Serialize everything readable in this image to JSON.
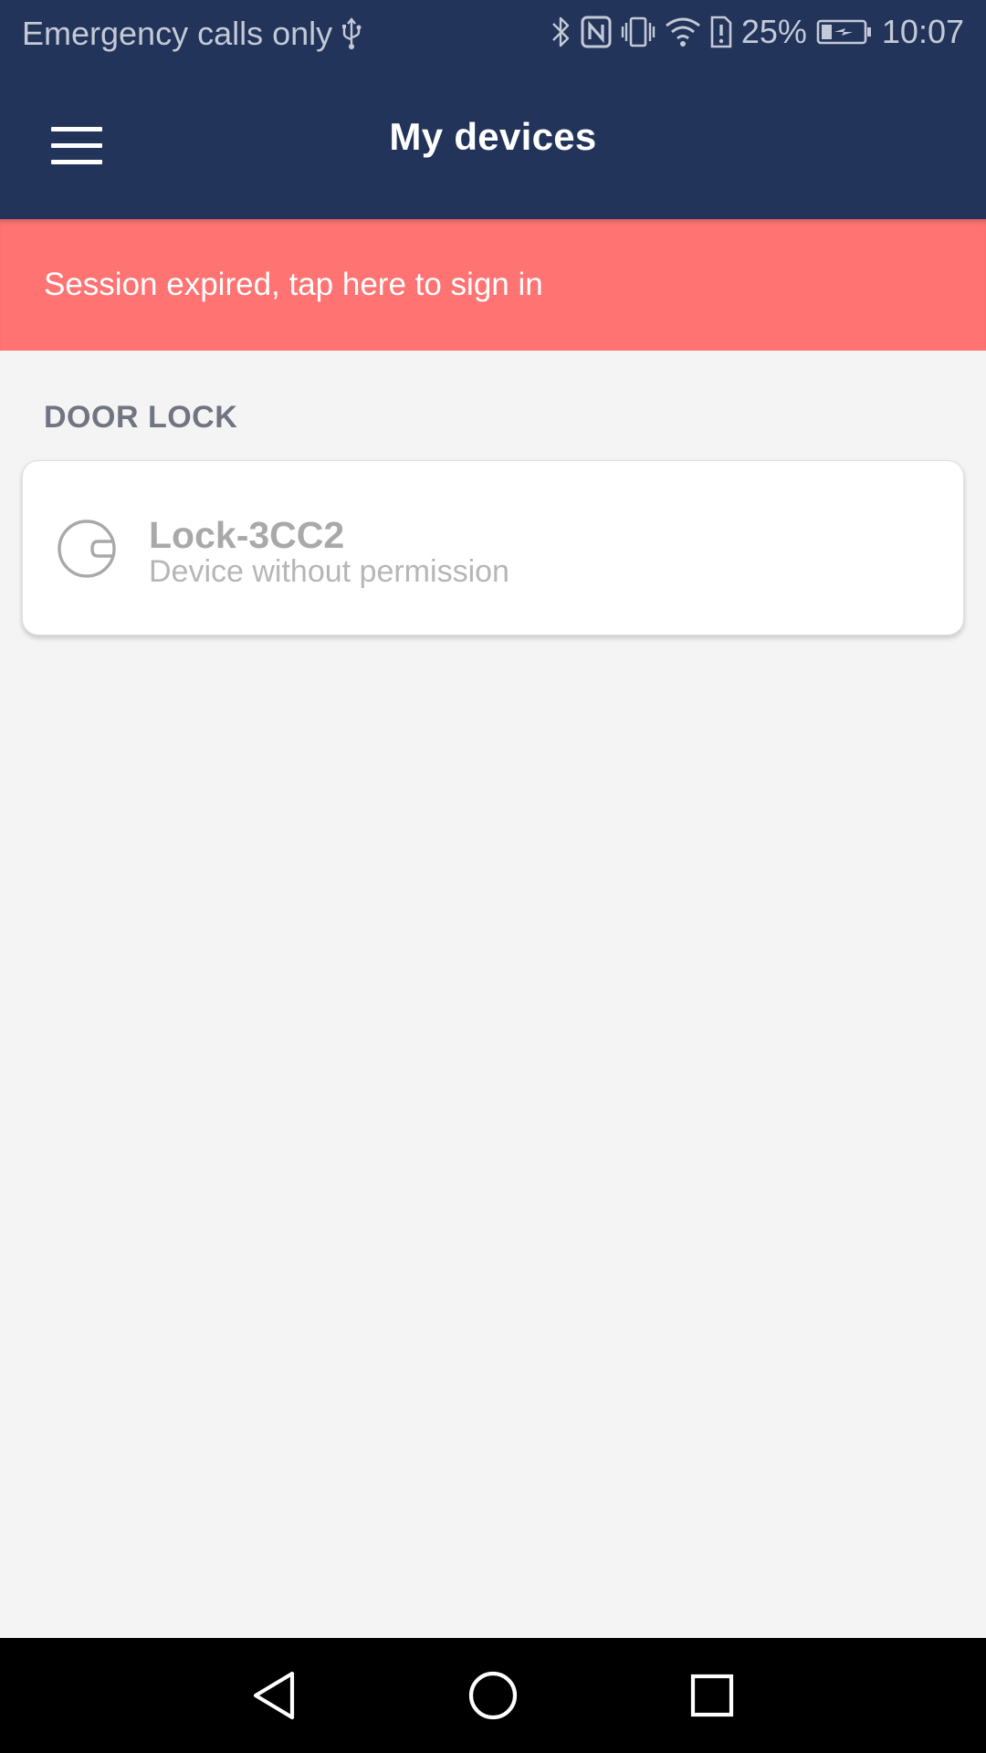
{
  "status_bar": {
    "carrier_text": "Emergency calls only",
    "battery_percent": "25%",
    "time": "10:07",
    "icons": [
      "usb-icon",
      "bluetooth-icon",
      "nfc-icon",
      "vibrate-icon",
      "wifi-icon",
      "alert-icon",
      "battery-charging-icon"
    ]
  },
  "header": {
    "title": "My devices",
    "menu_icon": "hamburger-menu-icon"
  },
  "banner": {
    "text": "Session expired, tap here to sign in",
    "color": "#ff7373"
  },
  "section": {
    "title": "DOOR LOCK"
  },
  "devices": [
    {
      "name": "Lock-3CC2",
      "status": "Device without permission",
      "icon": "lock-knob-icon"
    }
  ],
  "nav_bar": {
    "buttons": [
      "back-icon",
      "home-icon",
      "recents-icon"
    ]
  },
  "colors": {
    "primary": "#23345a",
    "banner": "#ff7373",
    "background": "#f4f4f4",
    "section_text": "#717582",
    "disabled_text": "#a9a9ab"
  }
}
